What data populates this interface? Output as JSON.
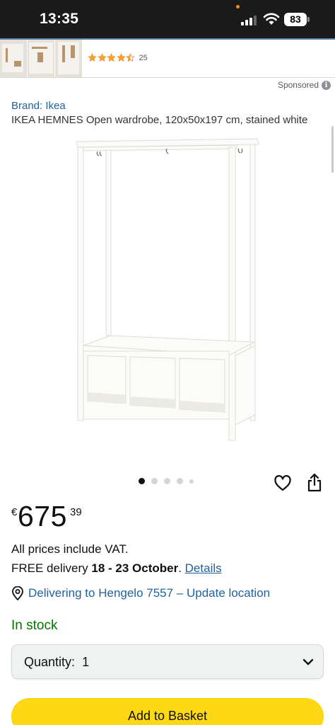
{
  "status_bar": {
    "time": "13:35",
    "battery": "83",
    "icons": [
      "signal-icon",
      "wifi-icon",
      "battery-icon"
    ]
  },
  "rating": {
    "stars": 4.5,
    "count": "25"
  },
  "sponsored": {
    "label": "Sponsored",
    "info_glyph": "i"
  },
  "product": {
    "brand": "Brand: Ikea",
    "title": "IKEA HEMNES Open wardrobe, 120x50x197 cm, stained white"
  },
  "carousel": {
    "total": 5,
    "active_index": 0
  },
  "actions": {
    "wishlist_icon": "heart-icon",
    "share_icon": "share-icon"
  },
  "price": {
    "symbol": "€",
    "whole": "675",
    "fraction": "39"
  },
  "vat_text": "All prices include VAT.",
  "delivery": {
    "prefix": "FREE delivery ",
    "dates": "18 - 23 October",
    "suffix": ". ",
    "link": "Details"
  },
  "location": {
    "text": "Delivering to Hengelo 7557 – Update location"
  },
  "stock": "In stock",
  "quantity": {
    "label": "Quantity:",
    "value": "1"
  },
  "add_to_basket": "Add to Basket",
  "colors": {
    "link": "#2162a1",
    "in_stock": "#007600",
    "basket_button": "#ffd814",
    "star": "#ffa41c"
  }
}
